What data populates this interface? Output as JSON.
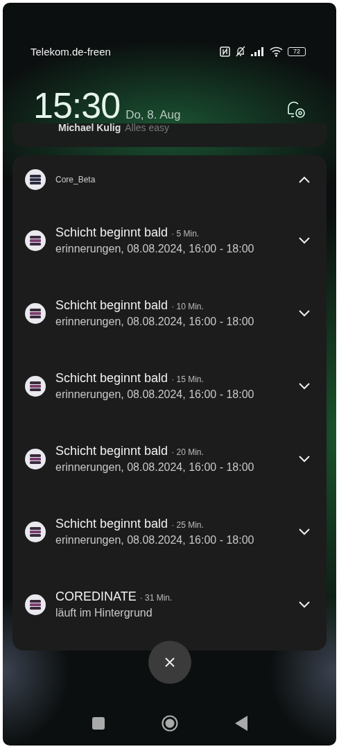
{
  "status_bar": {
    "carrier": "Telekom.de-freen",
    "battery": "72"
  },
  "lock_clock": {
    "time": "15:30",
    "date": "Do, 8. Aug"
  },
  "previous_notification": {
    "sender": "Michael Kulig",
    "message": "Alles easy"
  },
  "group": {
    "app_name": "Core_Beta",
    "expanded": true,
    "notifications": [
      {
        "title": "Schicht beginnt bald",
        "time": "· 5 Min.",
        "text": "erinnerungen, 08.08.2024, 16:00 - 18:00",
        "expanded": false
      },
      {
        "title": "Schicht beginnt bald",
        "time": "· 10 Min.",
        "text": "erinnerungen, 08.08.2024, 16:00 - 18:00",
        "expanded": false
      },
      {
        "title": "Schicht beginnt bald",
        "time": "· 15 Min.",
        "text": "erinnerungen, 08.08.2024, 16:00 - 18:00",
        "expanded": false
      },
      {
        "title": "Schicht beginnt bald",
        "time": "· 20 Min.",
        "text": "erinnerungen, 08.08.2024, 16:00 - 18:00",
        "expanded": false
      },
      {
        "title": "Schicht beginnt bald",
        "time": "· 25 Min.",
        "text": "erinnerungen, 08.08.2024, 16:00 - 18:00",
        "expanded": false
      },
      {
        "title": "COREDINATE",
        "time": "· 31 Min.",
        "text": "läuft im Hintergrund",
        "expanded": false
      }
    ]
  }
}
